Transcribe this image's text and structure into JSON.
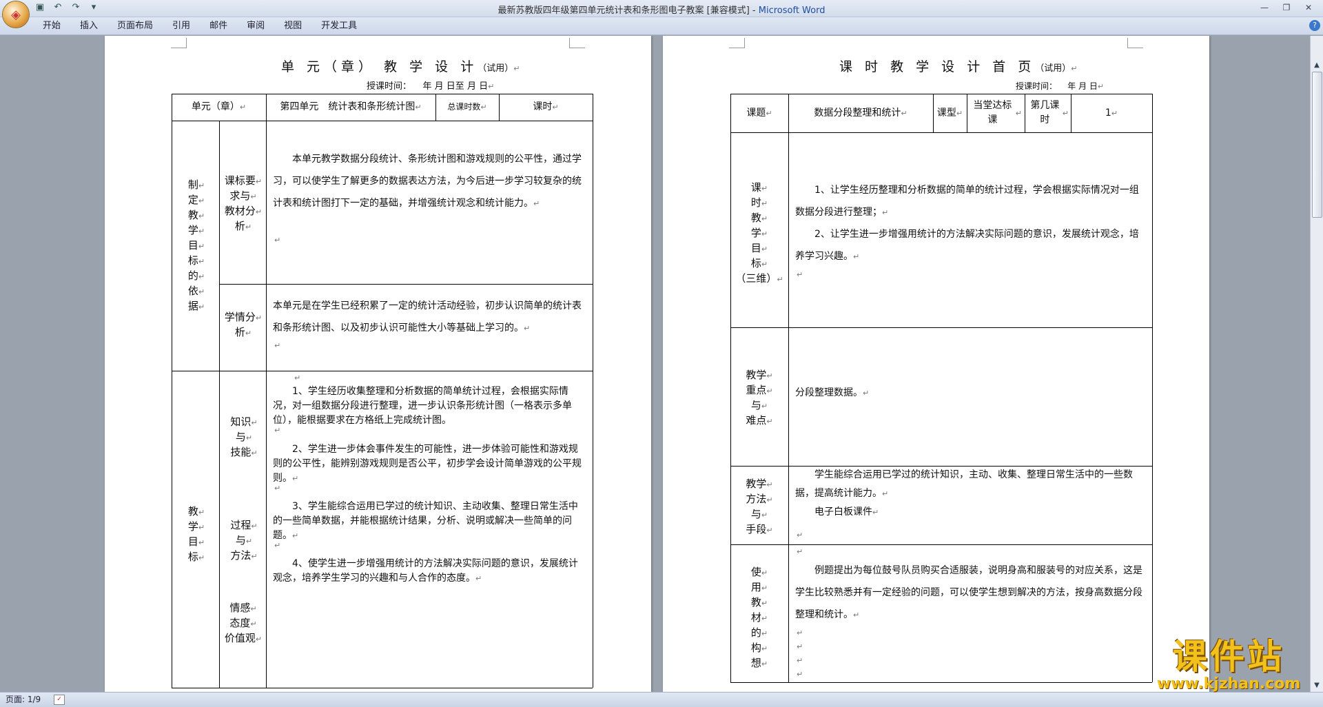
{
  "window": {
    "title": "最新苏教版四年级第四单元统计表和条形图电子教案 [兼容模式] - Microsoft Word",
    "title_doc": "最新苏教版四年级第四单元统计表和条形图电子教案 [兼容模式] - ",
    "title_app": "Microsoft Word"
  },
  "ribbon": {
    "tabs": [
      "开始",
      "插入",
      "页面布局",
      "引用",
      "邮件",
      "审阅",
      "视图",
      "开发工具"
    ]
  },
  "status": {
    "page": "页面: 1/9"
  },
  "left_page": {
    "title": "单 元（章） 教 学 设 计",
    "title_suffix": "（试用）",
    "date_label": "授课时间：",
    "date_fields": "年      月      日至      月      日",
    "row1": {
      "unit_label": "单元（章）",
      "unit_value": "第四单元　统计表和条形统计图",
      "total_label": "总课时数",
      "hours_label": "课时"
    },
    "basis_label": [
      "制",
      "定",
      "教",
      "学",
      "目",
      "标",
      "的",
      "依",
      "据"
    ],
    "curriculum_label": [
      "课标要",
      "求与",
      "教材分",
      "析"
    ],
    "curriculum_text": "本单元教学数据分段统计、条形统计图和游戏规则的公平性，通过学习，可以使学生了解更多的数据表达方法，为今后进一步学习较复杂的统计表和统计图打下一定的基础，并增强统计观念和统计能力。",
    "student_label": [
      "学情分",
      "析"
    ],
    "student_text": "本单元是在学生已经积累了一定的统计活动经验，初步认识简单的统计表和条形统计图、以及初步认识可能性大小等基础上学习的。",
    "goals_label": [
      "教",
      "学",
      "目",
      "标"
    ],
    "dims": {
      "knowledge": [
        "知识",
        "与",
        "技能"
      ],
      "process": [
        "过程",
        "与",
        "方法"
      ],
      "emotion": [
        "情感",
        "态度",
        "价值观"
      ]
    },
    "goals": [
      "1、学生经历收集整理和分析数据的简单统计过程，会根据实际情况，对一组数据分段进行整理，进一步认识条形统计图（一格表示多单位），能根据要求在方格纸上完成统计图。",
      "2、学生进一步体会事件发生的可能性，进一步体验可能性和游戏规则的公平性，能辨别游戏规则是否公平，初步学会设计简单游戏的公平规则。",
      "3、学生能综合运用已学过的统计知识、主动收集、整理日常生活中的一些简单数据，并能根据统计结果，分析、说明或解决一些简单的问题。",
      "4、使学生进一步增强用统计的方法解决实际问题的意识，发展统计观念，培养学生学习的兴趣和与人合作的态度。"
    ]
  },
  "right_page": {
    "title": "课 时 教 学 设 计 首 页",
    "title_suffix": "（试用）",
    "date_label": "授课时间：",
    "date_fields": "年    月    日",
    "row1": {
      "topic_label": "课题",
      "topic_value": "数据分段整理和统计",
      "type_label": "课型",
      "type_value": "当堂达标课",
      "lesson_label": "第几课时",
      "lesson_value": "1"
    },
    "goal_label": [
      "课",
      "时",
      "教",
      "学",
      "目",
      "标",
      "（三维）"
    ],
    "goals": [
      "1、让学生经历整理和分析数据的简单的统计过程，学会根据实际情况对一组数据分段进行整理；",
      "2、让学生进一步增强用统计的方法解决实际问题的意识，发展统计观念，培养学习兴趣。"
    ],
    "key_label": [
      "教学",
      "重点",
      "与",
      "难点"
    ],
    "key_text": "分段整理数据。",
    "method_label": [
      "教学",
      "方法",
      "与",
      "手段"
    ],
    "method_text": "学生能综合运用已学过的统计知识，主动、收集、整理日常生活中的一些数据，提高统计能力。",
    "method_tool": "电子白板课件",
    "idea_label": [
      "使",
      "用",
      "教",
      "材",
      "的",
      "构",
      "想"
    ],
    "idea_text": "例题提出为每位鼓号队员购买合适服装，说明身高和服装号的对应关系，这是学生比较熟悉并有一定经验的问题，可以使学生想到解决的方法，按身高数据分段整理和统计。"
  },
  "watermark": {
    "main": "课件站",
    "url": "www.kjzhan.com"
  },
  "colors": {
    "title_bar": "#dce5f2",
    "workspace": "#9aa2ad",
    "watermark": "#f3c21a"
  }
}
